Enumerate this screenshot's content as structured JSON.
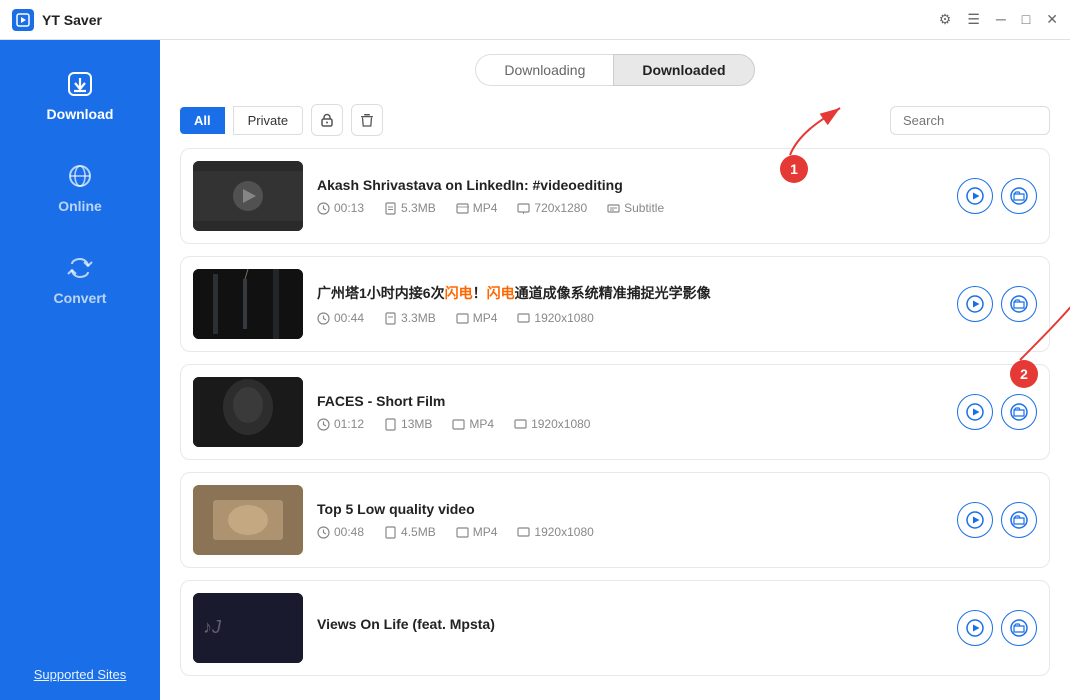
{
  "app": {
    "name": "YT Saver",
    "title_bar": {
      "settings_icon": "gear-icon",
      "menu_icon": "menu-icon",
      "minimize_icon": "minimize-icon",
      "maximize_icon": "maximize-icon",
      "close_icon": "close-icon"
    }
  },
  "sidebar": {
    "items": [
      {
        "id": "download",
        "label": "Download",
        "active": true
      },
      {
        "id": "online",
        "label": "Online",
        "active": false
      },
      {
        "id": "convert",
        "label": "Convert",
        "active": false
      }
    ],
    "supported_sites_label": "Supported Sites"
  },
  "tabs": {
    "downloading_label": "Downloading",
    "downloaded_label": "Downloaded",
    "active": "downloaded"
  },
  "toolbar": {
    "all_label": "All",
    "private_label": "Private",
    "search_placeholder": "Search"
  },
  "videos": [
    {
      "id": 1,
      "title": "Akash Shrivastava on LinkedIn: #videoediting",
      "duration": "00:13",
      "size": "5.3MB",
      "format": "MP4",
      "resolution": "720x1280",
      "subtitle": "Subtitle",
      "thumb_class": "thumb-img-1"
    },
    {
      "id": 2,
      "title_plain": "广州塔1小时内接6次",
      "title_highlight1": "闪电",
      "title_mid": "！",
      "title_highlight2": "闪电",
      "title_end": "通道成像系统精准捕捉光学影像",
      "duration": "00:44",
      "size": "3.3MB",
      "format": "MP4",
      "resolution": "1920x1080",
      "thumb_class": "thumb-img-2"
    },
    {
      "id": 3,
      "title": "FACES - Short Film",
      "duration": "01:12",
      "size": "13MB",
      "format": "MP4",
      "resolution": "1920x1080",
      "thumb_class": "thumb-img-3"
    },
    {
      "id": 4,
      "title": "Top 5 Low quality video",
      "duration": "00:48",
      "size": "4.5MB",
      "format": "MP4",
      "resolution": "1920x1080",
      "thumb_class": "thumb-img-4"
    },
    {
      "id": 5,
      "title": "Views On Life (feat. Mpsta)",
      "duration": "",
      "size": "",
      "format": "",
      "resolution": "",
      "thumb_class": "thumb-img-5"
    }
  ],
  "annotations": {
    "bubble1_label": "1",
    "bubble2_label": "2"
  },
  "colors": {
    "accent": "#1a6fe8",
    "sidebar_bg": "#1a6fe8",
    "annotation_red": "#e53935"
  }
}
